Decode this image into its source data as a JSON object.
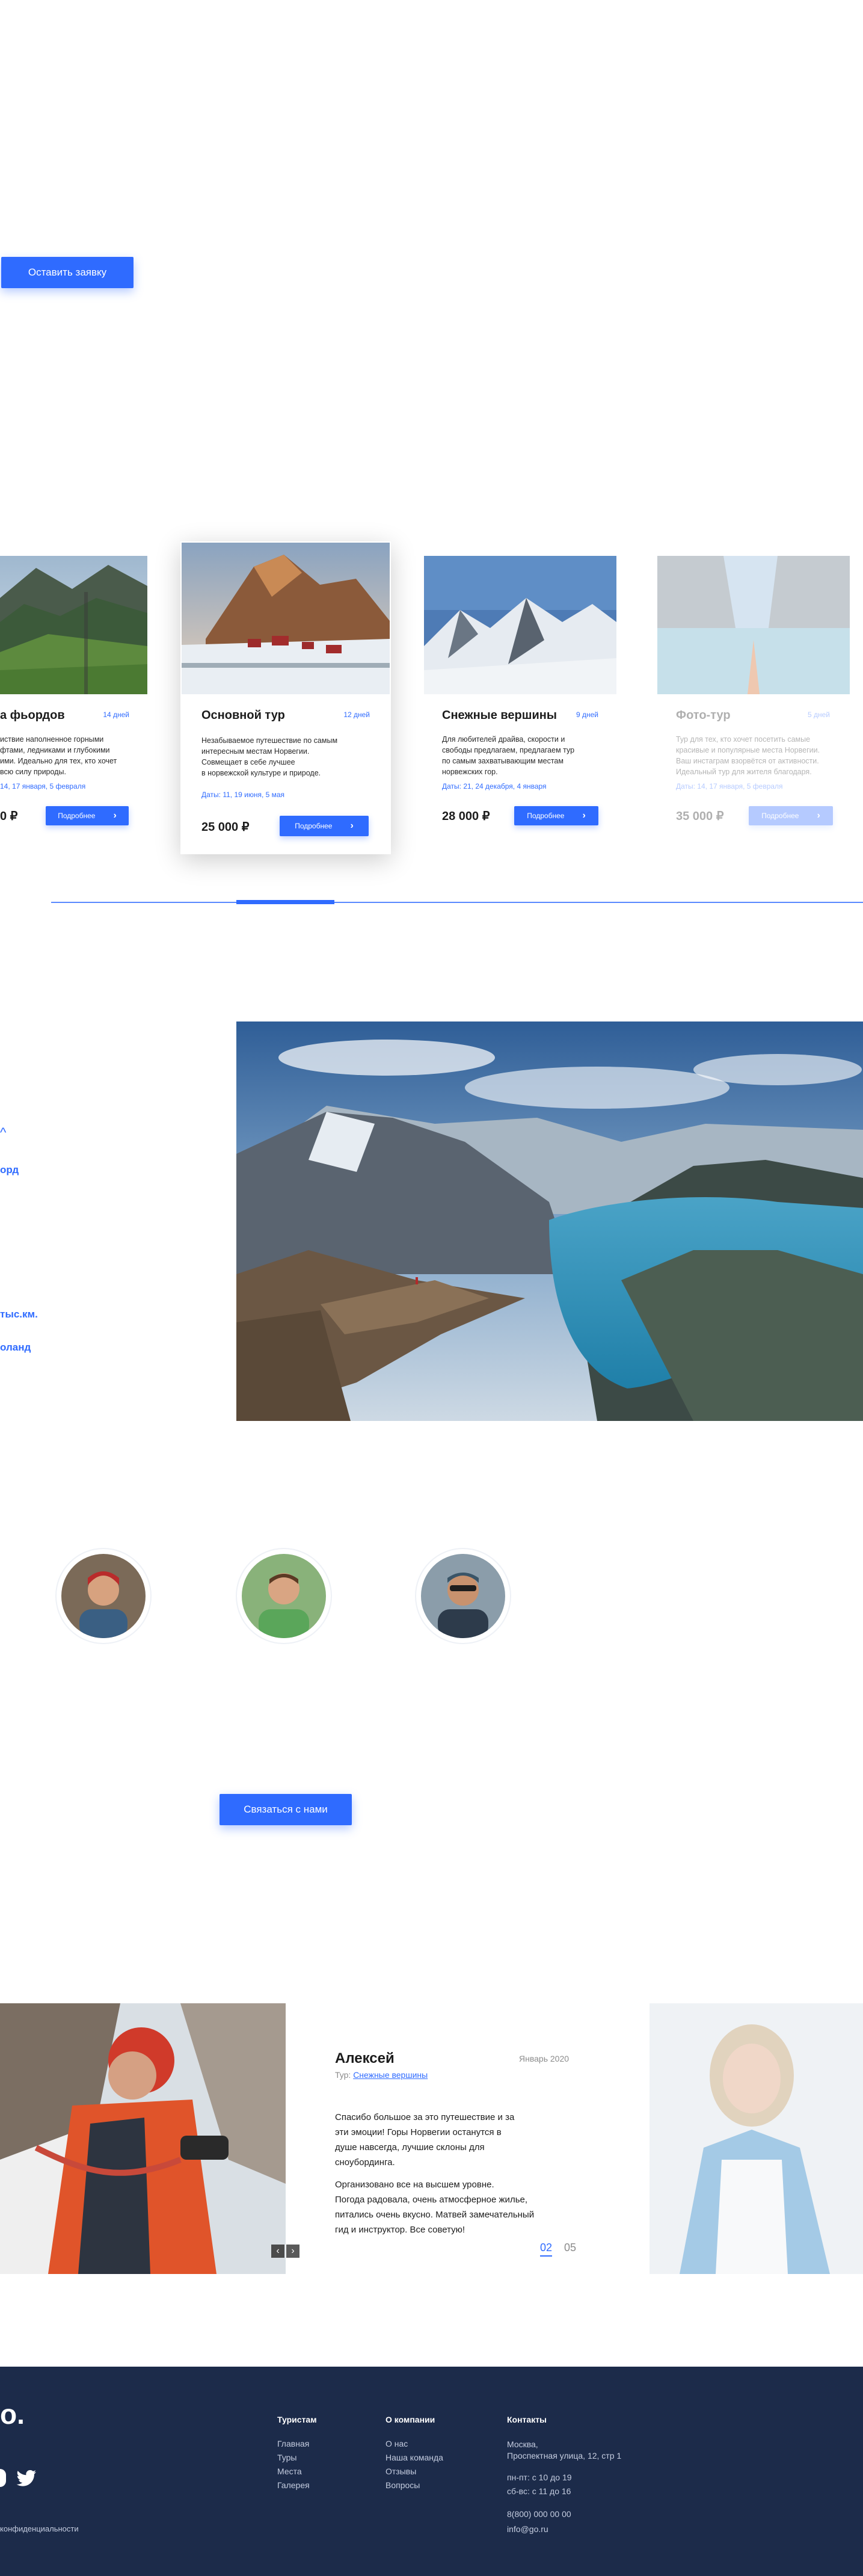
{
  "hero": {
    "cta_label": "Оставить заявку"
  },
  "tours": [
    {
      "title": "а фьордов",
      "days": "14 дней",
      "desc": [
        "иствие наполненное горными",
        "фтами, ледниками и глубокими",
        "ими. Идеально для тех, кто хочет",
        "всю силу природы."
      ],
      "dates": "14, 17 января, 5 февраля",
      "price": "0 ₽",
      "more": "Подробнее"
    },
    {
      "title": "Основной тур",
      "days": "12 дней",
      "desc": [
        "Незабываемое путешествие по самым",
        "интересным местам Норвегии.",
        "Совмещает в себе лучшее",
        "в норвежской культуре и природе."
      ],
      "dates": "Даты:  11, 19 июня, 5 мая",
      "price": "25 000 ₽",
      "more": "Подробнее"
    },
    {
      "title": "Снежные вершины",
      "days": "9 дней",
      "desc": [
        "Для любителей драйва, скорости и",
        "свободы предлагаем, предлагаем тур",
        "по самым захватывающим местам",
        "норвежских гор."
      ],
      "dates": "Даты:  21, 24 декабря, 4 января",
      "price": "28 000 ₽",
      "more": "Подробнее"
    },
    {
      "title": "Фото-тур",
      "days": "5 дней",
      "desc": [
        "Тур для тех, кто хочет посетить самые",
        "красивые и популярные места Норвегии.",
        "Ваш инстаграм взорвётся от активности.",
        "Идеальный тур для жителя благодаря."
      ],
      "dates": "Даты:  14, 17 января, 5 февраля",
      "price": "35 000 ₽",
      "more": "Подробнее"
    }
  ],
  "facts": {
    "chev": "^",
    "fjord": "орд",
    "area": "тыс.км.",
    "country": "оланд"
  },
  "team": {
    "contact_label": "Связаться с нами"
  },
  "review": {
    "name": "Алексей",
    "date": "Январь 2020",
    "tour_prefix": "Тур: ",
    "tour_link": "Снежные вершины",
    "p1": [
      "Спасибо большое за это путешествие и за",
      "эти эмоции! Горы Норвегии останутся в",
      "душе навсегда, лучшие склоны для",
      "сноубординга."
    ],
    "p2": [
      "Организовано все на высшем уровне.",
      "Погода радовала, очень атмосферное жилье,",
      "питались очень вкусно. Матвей замечательный",
      "гид и инструктор. Все советую!"
    ],
    "page_current": "02",
    "page_total": "05"
  },
  "footer": {
    "logo": "о.",
    "privacy": "конфиденциальности",
    "col1": {
      "title": "Туристам",
      "items": [
        "Главная",
        "Туры",
        "Места",
        "Галерея"
      ]
    },
    "col2": {
      "title": "О компании",
      "items": [
        "О нас",
        "Наша команда",
        "Отзывы",
        "Вопросы"
      ]
    },
    "col3": {
      "title": "Контакты",
      "address": [
        "Москва,",
        "Проспектная улица, 12, стр 1"
      ],
      "hours": [
        "пн-пт: с 10 до 19",
        "сб-вс: с 11 до 16"
      ],
      "phone": "8(800) 000 00 00",
      "email": "info@go.ru"
    }
  },
  "colors": {
    "accent": "#2f6bff",
    "footer_bg": "#1c2b4a"
  }
}
